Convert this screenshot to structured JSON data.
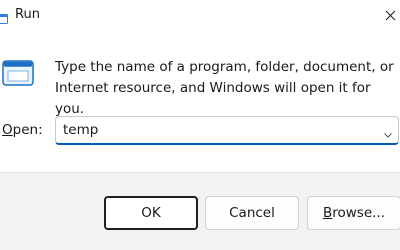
{
  "window": {
    "title": "Run",
    "icon": "run-icon"
  },
  "titlebar": {
    "close_icon": "close-icon"
  },
  "body": {
    "icon": "program-window-icon",
    "description": "Type the name of a program, folder, document, or Internet resource, and Windows will open it for you."
  },
  "open_field": {
    "label_accel": "O",
    "label_rest": "pen:",
    "value": "temp",
    "dropdown_icon": "chevron-down-icon"
  },
  "buttons": {
    "ok": "OK",
    "cancel": "Cancel",
    "browse_accel": "B",
    "browse_rest": "rowse..."
  },
  "colors": {
    "accent": "#005fb8",
    "footer_bg": "#f3f3f3",
    "text": "#1a1a1a"
  }
}
